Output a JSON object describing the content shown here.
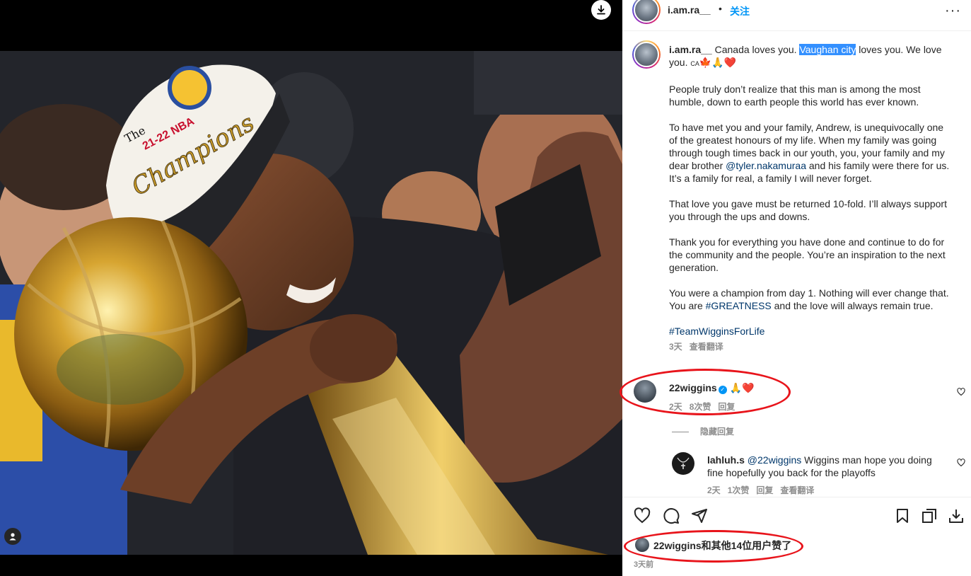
{
  "post": {
    "username": "i.am.ra__",
    "dot": "•",
    "follow_label": "关注",
    "more_label": "···"
  },
  "caption": {
    "username": "i.am.ra__",
    "line1_pre": " Canada loves you. ",
    "line1_highlight": "Vaughan city",
    "line1_post": " loves you. We love you. ",
    "flag_code": "CA",
    "emojis": "🍁🙏❤️",
    "para2": "People truly don’t realize that this man is among the most humble, down to earth people this world has ever known.",
    "para3_pre": "To have met you and your family, Andrew, is unequivocally one of the greatest honours of my life. When my family was going through tough times back in our youth, you, your family and my dear brother ",
    "para3_mention": "@tyler.nakamuraa",
    "para3_post": " and his family were there for us. It’s a family for real, a family I will never forget.",
    "para4": "That love you gave must be returned 10-fold. I’ll always support you through the ups and downs.",
    "para5": "Thank you for everything you have done and continue to do for the community and the people. You’re an inspiration to the next generation.",
    "para6_pre": "You were a champion from day 1. Nothing will ever change that. You are ",
    "para6_tag": "#GREATNESS",
    "para6_post": " and the love will always remain true.",
    "hashtag": "#TeamWigginsForLife",
    "time": "3天",
    "translate": "查看翻译"
  },
  "comments": [
    {
      "username": "22wiggins",
      "verified_mark": "✓",
      "text": "🙏❤️",
      "time": "2天",
      "likes": "8次赞",
      "reply": "回复"
    },
    {
      "username": "lahluh.s",
      "mention": "@22wiggins",
      "text": " Wiggins man hope you doing fine hopefully you back for the playoffs",
      "time": "2天",
      "likes": "1次赞",
      "reply": "回复",
      "translate": "查看翻译"
    }
  ],
  "hide_replies_label": "隐藏回复",
  "likes_summary": "22wiggins和其他14位用户赞了",
  "post_time": "3天前",
  "photo": {
    "cap_text_1": "The",
    "cap_text_2": "21-22 NBA",
    "cap_text_3": "Champions"
  },
  "colors": {
    "link": "#00376b",
    "follow": "#0095f6",
    "annotation": "#e8141b",
    "highlight": "#3390ff"
  },
  "icons": [
    "download-icon",
    "user-tag-icon",
    "more-icon",
    "heart-icon",
    "comment-icon",
    "share-icon",
    "save-icon",
    "verified-icon"
  ]
}
